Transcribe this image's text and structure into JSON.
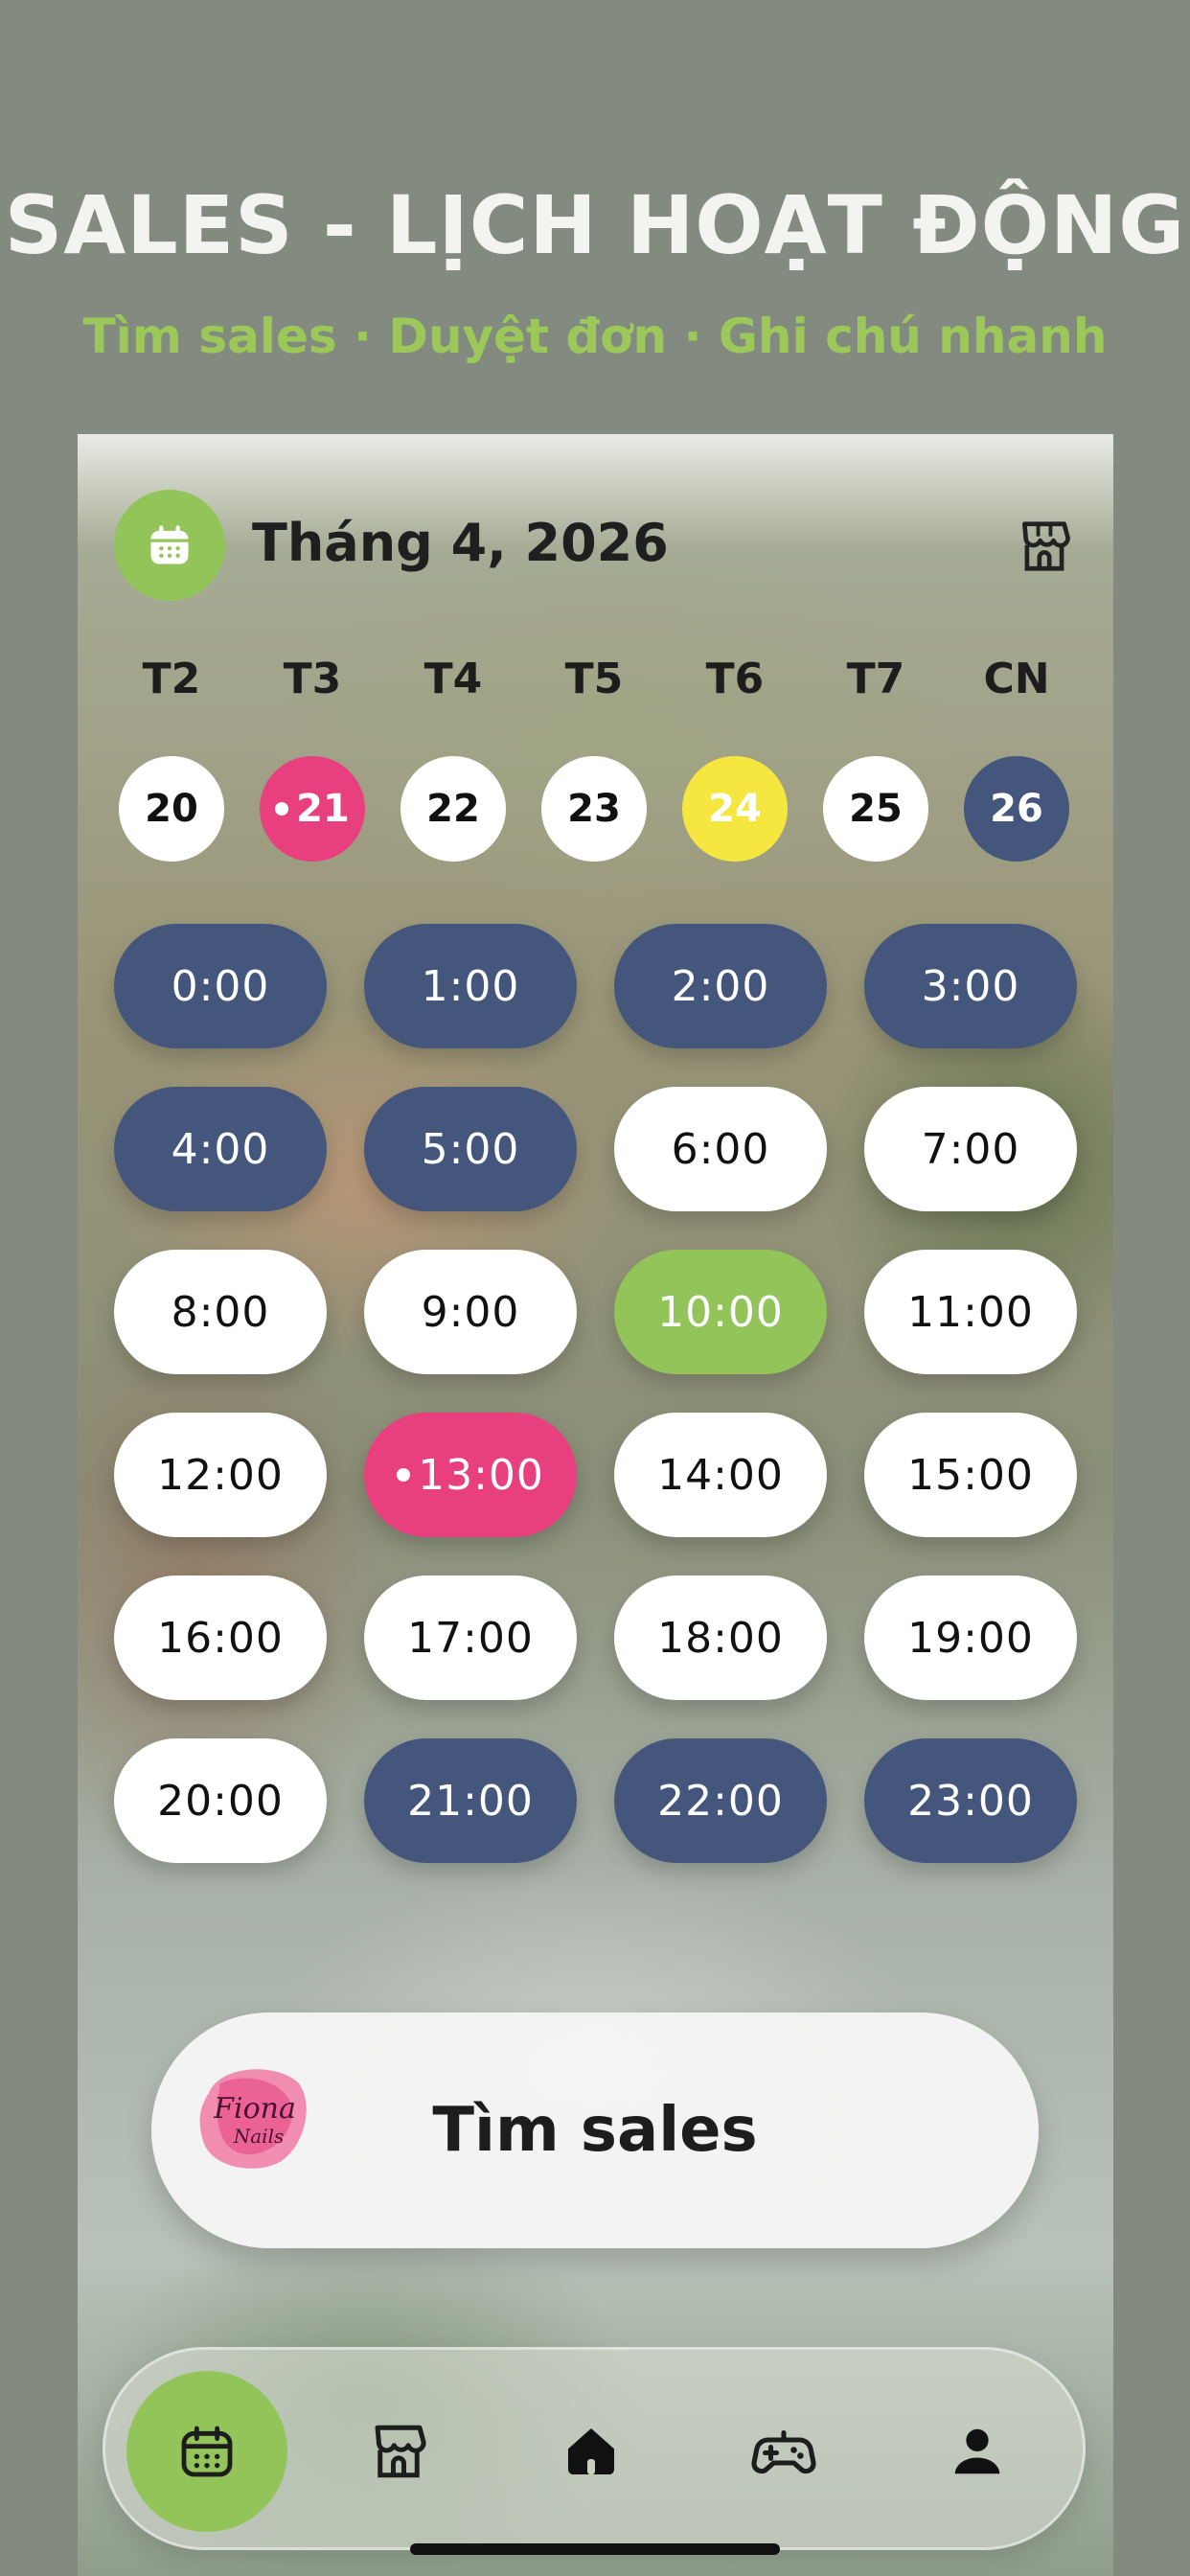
{
  "header": {
    "title": "SALES - LỊCH HOẠT ĐỘNG",
    "subtitle": "Tìm sales · Duyệt đơn · Ghi chú nhanh"
  },
  "calendar": {
    "month_label": "Tháng 4, 2026",
    "weekdays": [
      "T2",
      "T3",
      "T4",
      "T5",
      "T6",
      "T7",
      "CN"
    ],
    "days": [
      {
        "label": "20",
        "state": "default"
      },
      {
        "label": "21",
        "state": "marked-pink"
      },
      {
        "label": "22",
        "state": "default"
      },
      {
        "label": "23",
        "state": "default"
      },
      {
        "label": "24",
        "state": "today-yellow"
      },
      {
        "label": "25",
        "state": "default"
      },
      {
        "label": "26",
        "state": "selected-navy"
      }
    ]
  },
  "time_slots": [
    {
      "label": "0:00",
      "state": "navy"
    },
    {
      "label": "1:00",
      "state": "navy"
    },
    {
      "label": "2:00",
      "state": "navy"
    },
    {
      "label": "3:00",
      "state": "navy"
    },
    {
      "label": "4:00",
      "state": "navy"
    },
    {
      "label": "5:00",
      "state": "navy"
    },
    {
      "label": "6:00",
      "state": "white"
    },
    {
      "label": "7:00",
      "state": "white"
    },
    {
      "label": "8:00",
      "state": "white"
    },
    {
      "label": "9:00",
      "state": "white"
    },
    {
      "label": "10:00",
      "state": "green"
    },
    {
      "label": "11:00",
      "state": "white"
    },
    {
      "label": "12:00",
      "state": "white"
    },
    {
      "label": "13:00",
      "state": "pink",
      "dot": true
    },
    {
      "label": "14:00",
      "state": "white"
    },
    {
      "label": "15:00",
      "state": "white"
    },
    {
      "label": "16:00",
      "state": "white"
    },
    {
      "label": "17:00",
      "state": "white"
    },
    {
      "label": "18:00",
      "state": "white"
    },
    {
      "label": "19:00",
      "state": "white"
    },
    {
      "label": "20:00",
      "state": "white"
    },
    {
      "label": "21:00",
      "state": "navy"
    },
    {
      "label": "22:00",
      "state": "navy"
    },
    {
      "label": "23:00",
      "state": "navy"
    }
  ],
  "find_sales": {
    "label": "Tìm sales",
    "logo_text": "Fiona Nails"
  },
  "tabbar": {
    "items": [
      {
        "icon": "calendar-icon",
        "active": true
      },
      {
        "icon": "store-icon",
        "active": false
      },
      {
        "icon": "home-icon",
        "active": false
      },
      {
        "icon": "gamepad-icon",
        "active": false
      },
      {
        "icon": "user-icon",
        "active": false
      }
    ]
  },
  "colors": {
    "accent_green": "#93c45a",
    "navy": "#44567c",
    "pink": "#e8407e",
    "yellow": "#f5e640",
    "background": "#838b80"
  }
}
